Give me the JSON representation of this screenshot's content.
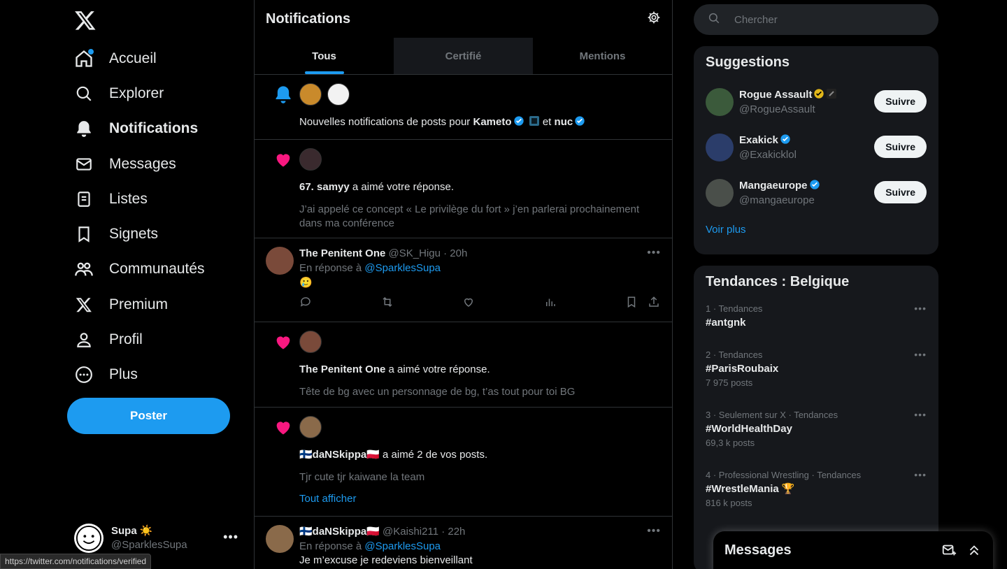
{
  "nav": {
    "items": [
      {
        "label": "Accueil",
        "icon": "home-icon"
      },
      {
        "label": "Explorer",
        "icon": "search-icon"
      },
      {
        "label": "Notifications",
        "icon": "bell-icon"
      },
      {
        "label": "Messages",
        "icon": "mail-icon"
      },
      {
        "label": "Listes",
        "icon": "list-icon"
      },
      {
        "label": "Signets",
        "icon": "bookmark-icon"
      },
      {
        "label": "Communautés",
        "icon": "communities-icon"
      },
      {
        "label": "Premium",
        "icon": "x-logo-icon"
      },
      {
        "label": "Profil",
        "icon": "person-icon"
      },
      {
        "label": "Plus",
        "icon": "more-circle-icon"
      }
    ],
    "post_label": "Poster",
    "account": {
      "name": "Supa ☀️",
      "handle": "@SparklesSupa"
    }
  },
  "status_url": "https://twitter.com/notifications/verified",
  "main": {
    "title": "Notifications",
    "tabs": [
      "Tous",
      "Certifié",
      "Mentions"
    ],
    "notif1": {
      "text_pre": "Nouvelles notifications de posts pour ",
      "name1": "Kameto",
      "and": " et ",
      "name2": "nuc"
    },
    "notif2": {
      "name": "67. samyy",
      "action": " a aimé votre réponse.",
      "quote": "J’ai appelé ce concept « Le privilège du fort » j’en parlerai prochainement dans ma conférence"
    },
    "post1": {
      "name": "The Penitent One",
      "meta": "@SK_Higu · 20h",
      "reply_prefix": "En réponse à ",
      "reply_handle": "@SparklesSupa",
      "body": "🥲"
    },
    "notif3": {
      "name": "The Penitent One",
      "action": " a aimé votre réponse.",
      "quote": "Tête de bg avec un personnage de bg, t’as tout pour toi BG"
    },
    "notif4": {
      "name": "🇫🇮daNSkippa🇵🇱",
      "action": " a aimé 2 de vos posts.",
      "quote": "Tjr cute tjr kaiwane la team",
      "show_all": "Tout afficher"
    },
    "post2": {
      "name": "🇫🇮daNSkippa🇵🇱",
      "meta": "@Kaishi211 · 22h",
      "reply_prefix": "En réponse à ",
      "reply_handle": "@SparklesSupa",
      "body": "Je m’excuse je redeviens bienveillant"
    }
  },
  "right": {
    "search_placeholder": "Chercher",
    "suggestions_title": "Suggestions",
    "suggestions": [
      {
        "name": "Rogue Assault",
        "handle": "@RogueAssault",
        "badge": "gold"
      },
      {
        "name": "Exakick",
        "handle": "@Exakicklol",
        "badge": "blue"
      },
      {
        "name": "Mangaeurope",
        "handle": "@mangaeurope",
        "badge": "blue"
      }
    ],
    "follow_label": "Suivre",
    "see_more": "Voir plus",
    "trends_title": "Tendances : Belgique",
    "trends": [
      {
        "meta": "1 · Tendances",
        "name": "#antgnk",
        "count": ""
      },
      {
        "meta": "2 · Tendances",
        "name": "#ParisRoubaix",
        "count": "7 975 posts"
      },
      {
        "meta": "3 · Seulement sur X · Tendances",
        "name": "#WorldHealthDay",
        "count": "69,3 k posts"
      },
      {
        "meta": "4 · Professional Wrestling · Tendances",
        "name": "#WrestleMania 🏆",
        "count": "816 k posts"
      }
    ]
  },
  "messages_drawer": {
    "title": "Messages"
  },
  "colors": {
    "accent": "#1d9bf0",
    "like": "#f91880",
    "gold": "#e2b719",
    "bg": "#000000"
  }
}
